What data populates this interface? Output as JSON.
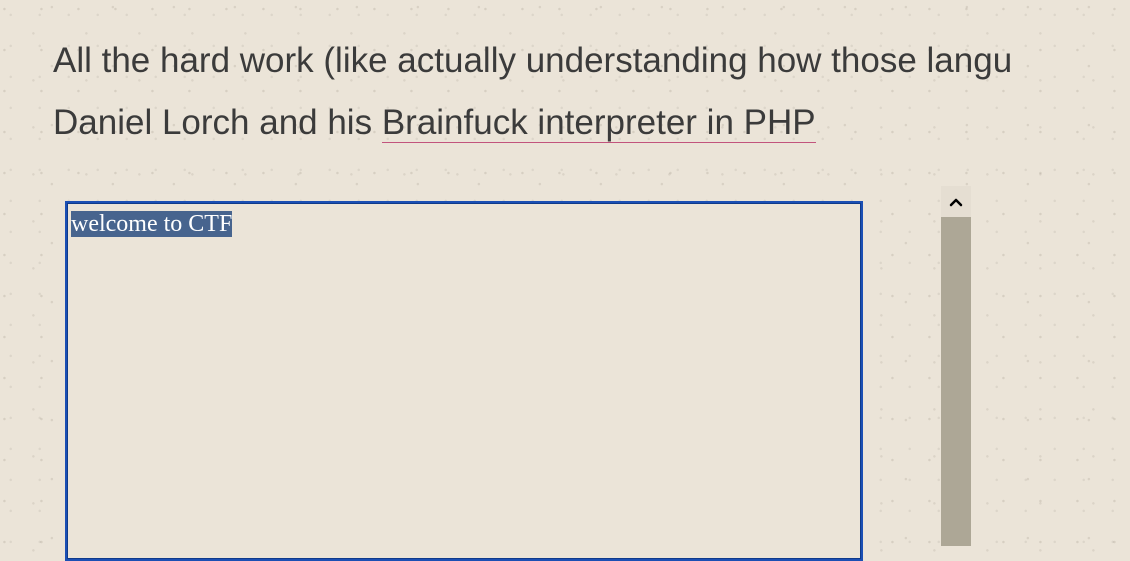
{
  "intro": {
    "line1": "All the hard work (like actually understanding how those langu",
    "line2_prefix": "Daniel Lorch and his ",
    "link_text": "Brainfuck interpreter in PHP"
  },
  "editor": {
    "selected_text": "welcome to CTF"
  },
  "scrollbar": {
    "up_icon": "chevron-up-icon"
  },
  "colors": {
    "page_background": "#ebe4d8",
    "text": "#3b3b3b",
    "link_underline": "#c2547d",
    "focus_border": "#1b4fb4",
    "selection": "#47648e",
    "scrollbar_track": "#ada796"
  }
}
